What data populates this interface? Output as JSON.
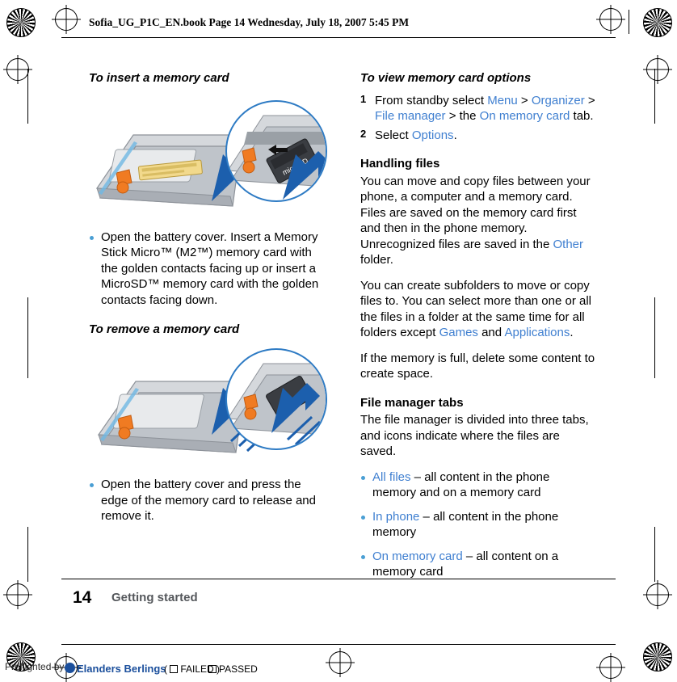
{
  "header": {
    "text": "Sofia_UG_P1C_EN.book  Page 14  Wednesday, July 18, 2007  5:45 PM"
  },
  "left_column": {
    "heading_insert": "To insert a memory card",
    "bullet_insert": "Open the battery cover. Insert a Memory Stick Micro™ (M2™) memory card with the golden contacts facing up or insert a MicroSD™ memory card with the golden contacts facing down.",
    "heading_remove": "To remove a memory card",
    "bullet_remove": "Open the battery cover and press the edge of the memory card to release and remove it.",
    "illustration_insert_label": "memory-card-insert-diagram",
    "illustration_remove_label": "memory-card-remove-diagram",
    "card_label": "microSD"
  },
  "right_column": {
    "heading_view_options": "To view memory card options",
    "steps": [
      {
        "num": "1",
        "parts": [
          {
            "text": "From standby select ",
            "style": "plain"
          },
          {
            "text": "Menu",
            "style": "link"
          },
          {
            "text": " > ",
            "style": "plain"
          },
          {
            "text": "Organizer",
            "style": "link"
          },
          {
            "text": " > ",
            "style": "plain"
          },
          {
            "text": "File manager",
            "style": "link"
          },
          {
            "text": " > the ",
            "style": "plain"
          },
          {
            "text": "On memory card",
            "style": "link"
          },
          {
            "text": " tab.",
            "style": "plain"
          }
        ]
      },
      {
        "num": "2",
        "parts": [
          {
            "text": "Select ",
            "style": "plain"
          },
          {
            "text": "Options",
            "style": "link"
          },
          {
            "text": ".",
            "style": "plain"
          }
        ]
      }
    ],
    "heading_handling_files": "Handling files",
    "para_handling_1_a": "You can move and copy files between your phone, a computer and a memory card. Files are saved on the memory card first and then in the phone memory. Unrecognized files are saved in the ",
    "para_handling_1_link": "Other",
    "para_handling_1_b": " folder.",
    "para_handling_2_a": "You can create subfolders to move or copy files to. You can select more than one or all the files in a folder at the same time for all folders except ",
    "para_handling_2_link1": "Games",
    "para_handling_2_mid": " and ",
    "para_handling_2_link2": "Applications",
    "para_handling_2_b": ".",
    "para_handling_3": "If the memory is full, delete some content to create space.",
    "heading_file_manager_tabs": "File manager tabs",
    "para_tabs": "The file manager is divided into three tabs, and icons indicate where the files are saved.",
    "tab_bullets": [
      {
        "link": "All files",
        "rest": " – all content in the phone memory and on a memory card"
      },
      {
        "link": "In phone",
        "rest": " – all content in the phone memory"
      },
      {
        "link": "On memory card",
        "rest": " – all content on a memory card"
      }
    ]
  },
  "footer": {
    "page_number": "14",
    "chapter": "Getting started",
    "preflight": "Preflighted by",
    "company": "Elanders Berlings",
    "failed_label": "FAILED",
    "passed_label": "PASSED"
  },
  "colors": {
    "link_blue": "#3f7fd0",
    "bullet_blue": "#4a9fd4",
    "footer_gray": "#55585c",
    "arrow_blue": "#1c5fad",
    "phone_gray": "#c9cdd2",
    "contact_orange": "#f07b22"
  }
}
